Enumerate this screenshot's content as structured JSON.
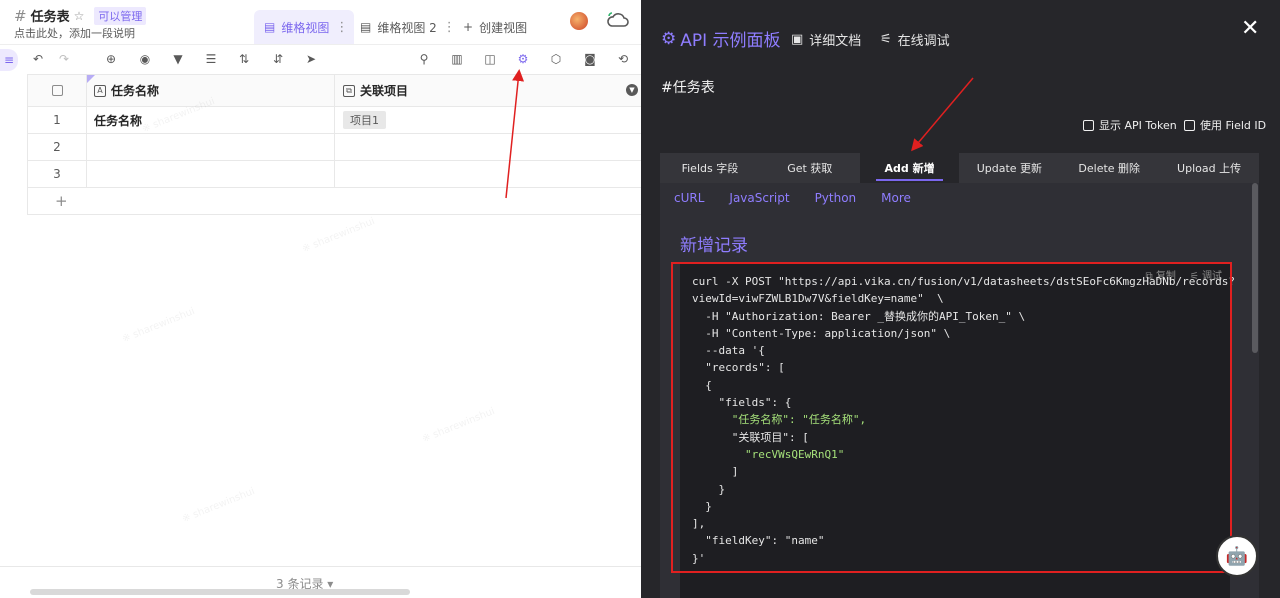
{
  "left": {
    "sheet_title": "任务表",
    "permission_badge": "可以管理",
    "description": "点击此处，添加一段说明",
    "tabs": [
      {
        "label": "维格视图"
      },
      {
        "label": "维格视图 2"
      },
      {
        "label": "创建视图"
      }
    ],
    "columns": [
      {
        "label": "任务名称"
      },
      {
        "label": "关联项目"
      }
    ],
    "rows": [
      {
        "num": "1",
        "name": "任务名称",
        "project": "项目1"
      },
      {
        "num": "2",
        "name": "",
        "project": ""
      },
      {
        "num": "3",
        "name": "",
        "project": ""
      }
    ],
    "add_row": "+",
    "record_count": "3 条记录 ▾"
  },
  "right": {
    "title": "API 示例面板",
    "doc_link": "详细文档",
    "debug_link": "在线调试",
    "sheet_heading": "#任务表",
    "options": [
      {
        "label": "显示 API Token"
      },
      {
        "label": "使用 Field ID"
      }
    ],
    "api_tabs": [
      {
        "label": "Fields 字段"
      },
      {
        "label": "Get 获取"
      },
      {
        "label": "Add 新增"
      },
      {
        "label": "Update 更新"
      },
      {
        "label": "Delete 删除"
      },
      {
        "label": "Upload 上传"
      }
    ],
    "languages": [
      {
        "label": "cURL"
      },
      {
        "label": "JavaScript"
      },
      {
        "label": "Python"
      },
      {
        "label": "More"
      }
    ],
    "section_title": "新增记录",
    "code_tools": {
      "copy": "复制",
      "debug": "调试"
    },
    "code_lines": [
      "curl -X POST \"https://api.vika.cn/fusion/v1/datasheets/dstSEoFc6KmgzHaDNb/records?",
      "viewId=viwFZWLB1Dw7V&fieldKey=name\"  \\",
      "  -H \"Authorization: Bearer _替换成你的API_Token_\" \\",
      "  -H \"Content-Type: application/json\" \\",
      "  --data '{",
      "  \"records\": [",
      "  {",
      "    \"fields\": {",
      "      \"任务名称\": \"任务名称\",",
      "      \"关联项目\": [",
      "        \"recVWsQEwRnQ1\"",
      "      ]",
      "    }",
      "  }",
      "],",
      "  \"fieldKey\": \"name\"",
      "}'"
    ]
  },
  "colors": {
    "accent": "#7b67ee",
    "panel_bg": "#26262a",
    "highlight": "#e02020"
  }
}
